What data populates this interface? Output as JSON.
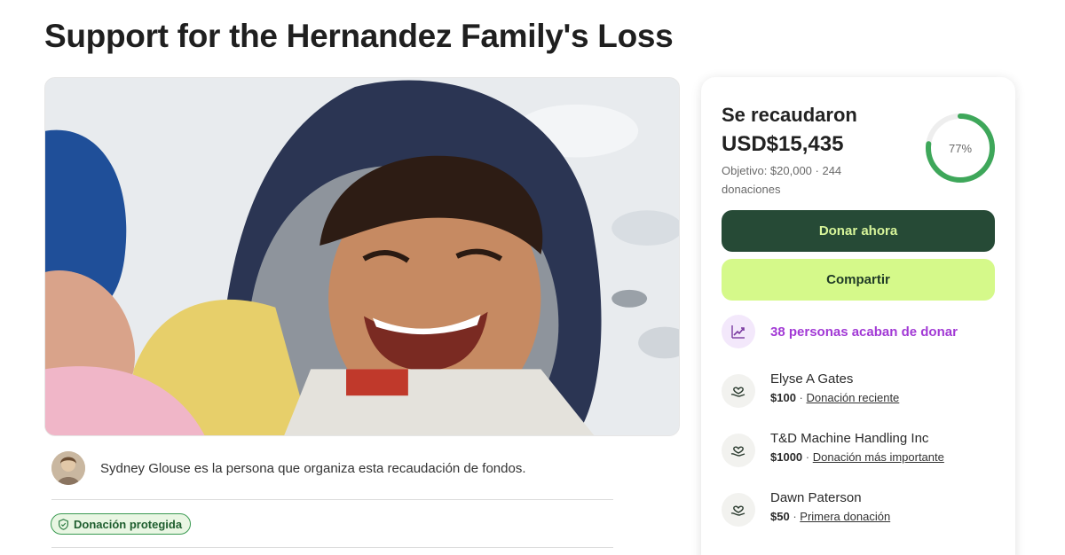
{
  "page": {
    "title": "Support for the Hernandez Family's Loss"
  },
  "organizer": {
    "text": "Sydney Glouse es la persona que organiza esta recaudación de fondos."
  },
  "badge": {
    "protected_label": "Donación protegida"
  },
  "card": {
    "raised_label": "Se recaudaron",
    "raised_amount": "USD$15,435",
    "goal_text": "Objetivo: $20,000 · 244 donaciones",
    "progress_percent_label": "77%",
    "progress_fraction": 0.77,
    "donate_label": "Donar ahora",
    "share_label": "Compartir",
    "recent_donors_text": "38 personas acaban de donar",
    "donations": [
      {
        "name": "Elyse A Gates",
        "amount": "$100",
        "tag": "Donación reciente"
      },
      {
        "name": "T&D Machine Handling Inc",
        "amount": "$1000",
        "tag": "Donación más importante"
      },
      {
        "name": "Dawn Paterson",
        "amount": "$50",
        "tag": "Primera donación"
      }
    ]
  },
  "icons": {
    "trend": "trend-up-icon",
    "donor": "heart-hand-icon",
    "shield": "shield-icon"
  },
  "colors": {
    "donate_bg": "#264a36",
    "donate_text": "#d7f59a",
    "share_bg": "#d5f98a",
    "progress": "#3ea75a",
    "recent_text": "#a23ad5"
  }
}
